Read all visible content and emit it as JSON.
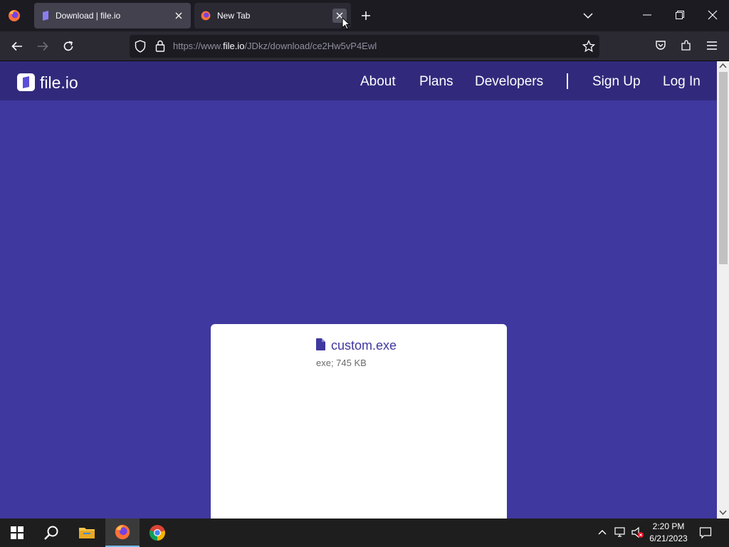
{
  "browser": {
    "tabs": [
      {
        "title": "Download | file.io",
        "active": false
      },
      {
        "title": "New Tab",
        "active": true
      }
    ],
    "url": {
      "prefix": "https://www.",
      "host": "file.io",
      "path": "/JDkz/download/ce2Hw5vP4Ewl"
    }
  },
  "site": {
    "logo_text": "file.io",
    "nav": {
      "about": "About",
      "plans": "Plans",
      "developers": "Developers",
      "signup": "Sign Up",
      "login": "Log In"
    },
    "file": {
      "name": "custom.exe",
      "meta": "exe; 745 KB"
    }
  },
  "taskbar": {
    "time": "2:20 PM",
    "date": "6/21/2023"
  },
  "colors": {
    "page_bg": "#3f389f",
    "header_bg": "#312a7c",
    "browser_bg": "#1c1b22"
  }
}
